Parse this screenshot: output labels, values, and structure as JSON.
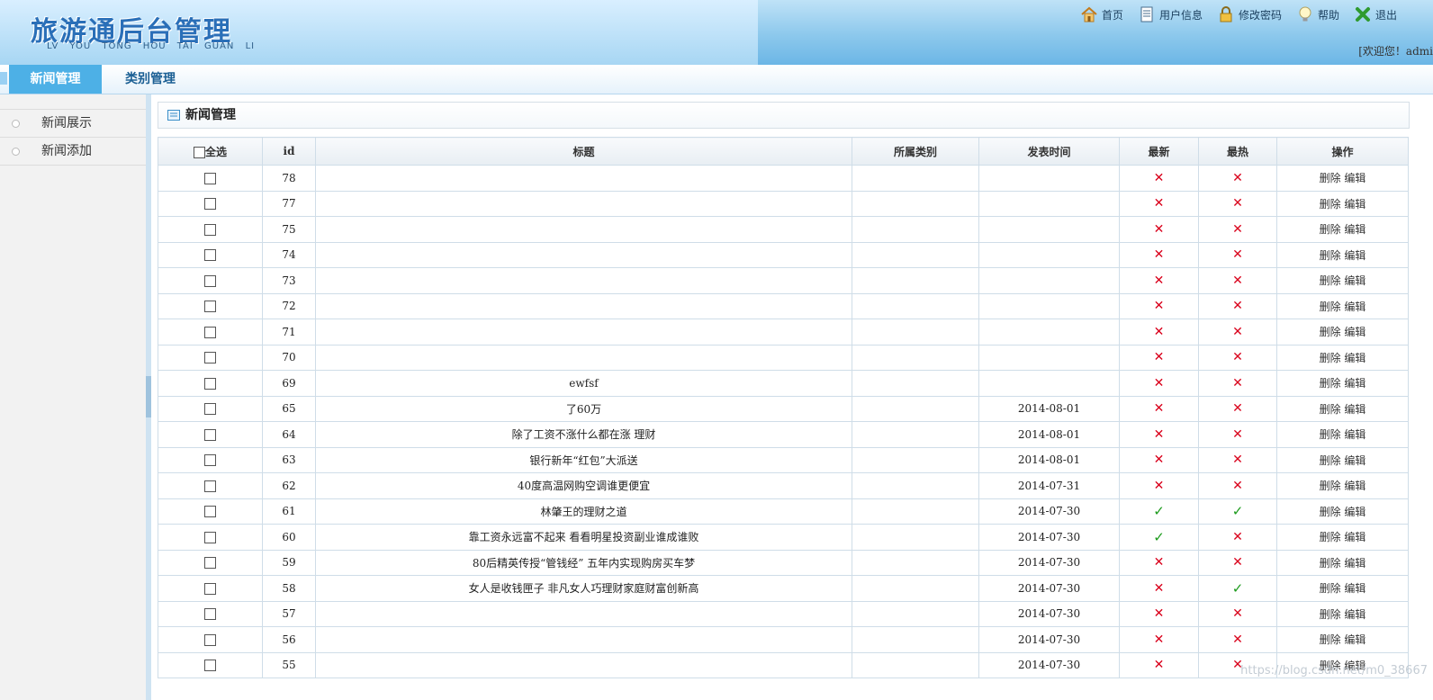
{
  "header": {
    "logo_title": "旅游通后台管理",
    "logo_sub": "LV YOU TONG HOU TAI GUAN LI",
    "nav": [
      {
        "label": "首页",
        "icon": "home-icon"
      },
      {
        "label": "用户信息",
        "icon": "document-icon"
      },
      {
        "label": "修改密码",
        "icon": "lock-icon"
      },
      {
        "label": "帮助",
        "icon": "lightbulb-icon"
      },
      {
        "label": "退出",
        "icon": "exit-icon"
      }
    ],
    "welcome": "[欢迎您！admi"
  },
  "tabs": [
    {
      "label": "新闻管理",
      "active": true
    },
    {
      "label": "类别管理",
      "active": false
    }
  ],
  "sidebar": {
    "items": [
      {
        "label": "新闻展示"
      },
      {
        "label": "新闻添加"
      }
    ]
  },
  "panel": {
    "title": "新闻管理"
  },
  "table": {
    "columns": [
      "全选",
      "id",
      "标题",
      "所属类别",
      "发表时间",
      "最新",
      "最热",
      "操作"
    ],
    "op_delete": "删除",
    "op_edit": "编辑",
    "rows": [
      {
        "id": "78",
        "title": "",
        "category": "",
        "date": "",
        "latest": "✕",
        "hot": "✕"
      },
      {
        "id": "77",
        "title": "",
        "category": "",
        "date": "",
        "latest": "✕",
        "hot": "✕"
      },
      {
        "id": "75",
        "title": "",
        "category": "",
        "date": "",
        "latest": "✕",
        "hot": "✕"
      },
      {
        "id": "74",
        "title": "",
        "category": "",
        "date": "",
        "latest": "✕",
        "hot": "✕"
      },
      {
        "id": "73",
        "title": "",
        "category": "",
        "date": "",
        "latest": "✕",
        "hot": "✕"
      },
      {
        "id": "72",
        "title": "",
        "category": "",
        "date": "",
        "latest": "✕",
        "hot": "✕"
      },
      {
        "id": "71",
        "title": "",
        "category": "",
        "date": "",
        "latest": "✕",
        "hot": "✕"
      },
      {
        "id": "70",
        "title": "",
        "category": "",
        "date": "",
        "latest": "✕",
        "hot": "✕"
      },
      {
        "id": "69",
        "title": "ewfsf",
        "category": "",
        "date": "",
        "latest": "✕",
        "hot": "✕"
      },
      {
        "id": "65",
        "title": "了60万",
        "category": "",
        "date": "2014-08-01",
        "latest": "✕",
        "hot": "✕"
      },
      {
        "id": "64",
        "title": "除了工资不涨什么都在涨 理财",
        "category": "",
        "date": "2014-08-01",
        "latest": "✕",
        "hot": "✕"
      },
      {
        "id": "63",
        "title": "银行新年“红包”大派送",
        "category": "",
        "date": "2014-08-01",
        "latest": "✕",
        "hot": "✕"
      },
      {
        "id": "62",
        "title": "40度高温网购空调谁更便宜",
        "category": "",
        "date": "2014-07-31",
        "latest": "✕",
        "hot": "✕"
      },
      {
        "id": "61",
        "title": "林肇王的理财之道",
        "category": "",
        "date": "2014-07-30",
        "latest": "✓",
        "hot": "✓"
      },
      {
        "id": "60",
        "title": "靠工资永远富不起来 看看明星投资副业谁成谁败",
        "category": "",
        "date": "2014-07-30",
        "latest": "✓",
        "hot": "✕"
      },
      {
        "id": "59",
        "title": "80后精英传授“管钱经” 五年内实现购房买车梦",
        "category": "",
        "date": "2014-07-30",
        "latest": "✕",
        "hot": "✕"
      },
      {
        "id": "58",
        "title": "女人是收钱匣子 非凡女人巧理财家庭财富创新高",
        "category": "",
        "date": "2014-07-30",
        "latest": "✕",
        "hot": "✓"
      },
      {
        "id": "57",
        "title": "",
        "category": "",
        "date": "2014-07-30",
        "latest": "✕",
        "hot": "✕"
      },
      {
        "id": "56",
        "title": "",
        "category": "",
        "date": "2014-07-30",
        "latest": "✕",
        "hot": "✕"
      },
      {
        "id": "55",
        "title": "",
        "category": "",
        "date": "2014-07-30",
        "latest": "✕",
        "hot": "✕"
      }
    ]
  },
  "watermark": "https://blog.csdn.net/m0_38667"
}
